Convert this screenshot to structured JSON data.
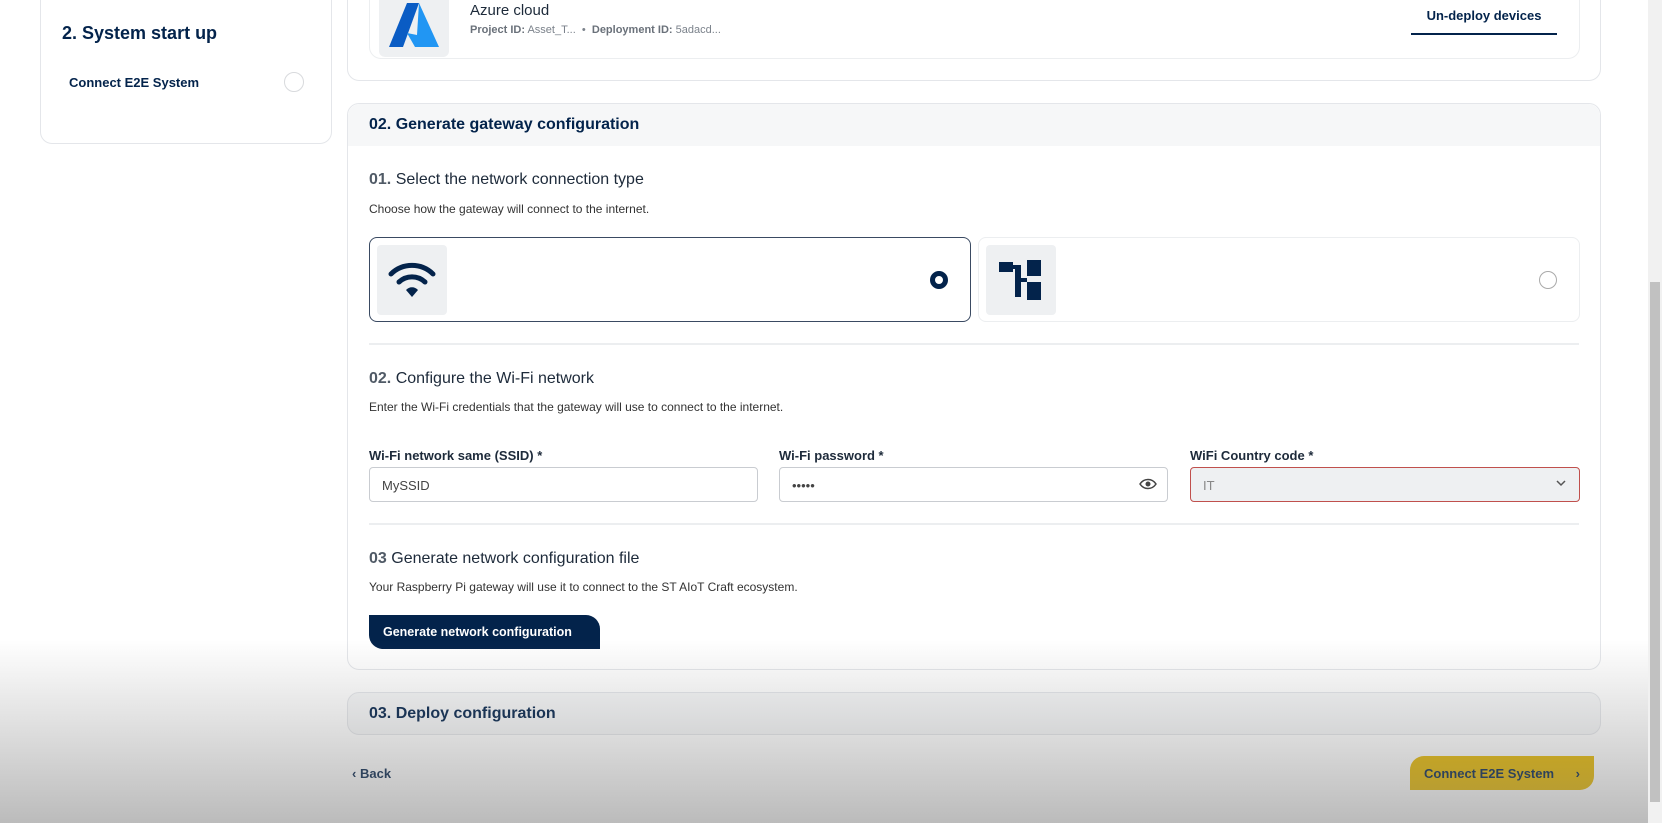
{
  "sidebar": {
    "section_title": "2. System start up",
    "items": [
      {
        "label": "Connect E2E System"
      }
    ]
  },
  "cloud": {
    "name": "Azure cloud",
    "project_label": "Project ID:",
    "project_value": "Asset_T...",
    "deployment_label": "Deployment ID:",
    "deployment_value": "5adacd...",
    "separator": "•",
    "undeploy_label": "Un-deploy devices"
  },
  "gateway": {
    "title": "02. Generate gateway configuration",
    "step1": {
      "num": "01.",
      "title": "Select the network connection type",
      "desc": "Choose how the gateway will connect to the internet.",
      "options": [
        {
          "icon": "wifi-icon",
          "selected": true
        },
        {
          "icon": "ethernet-icon",
          "selected": false
        }
      ]
    },
    "step2": {
      "num": "02.",
      "title": "Configure the Wi-Fi network",
      "desc": "Enter the Wi-Fi credentials that the gateway will use to connect to the internet.",
      "ssid_label": "Wi-Fi network same (SSID) *",
      "ssid_value": "MySSID",
      "password_label": "Wi-Fi password *",
      "password_value": "•••••",
      "country_label": "WiFi Country code *",
      "country_value": "IT"
    },
    "step3": {
      "num": "03",
      "title": "Generate network configuration file",
      "desc": "Your Raspberry Pi gateway will use it to connect to the ST AIoT Craft ecosystem.",
      "button": "Generate network configuration"
    }
  },
  "deploy": {
    "title": "03. Deploy configuration"
  },
  "footer": {
    "back": "Back",
    "next": "Connect E2E System"
  }
}
